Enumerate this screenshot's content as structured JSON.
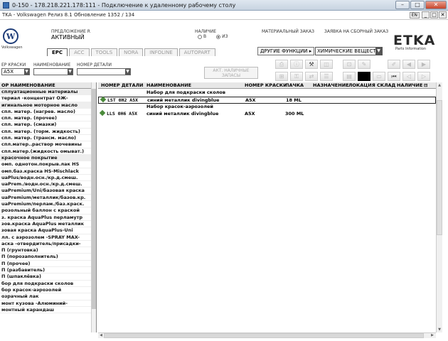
{
  "rdp": {
    "title": "0-150 - 178.218.221.178:111 - Подключение к удаленному рабочему столу",
    "min": "–",
    "max": "□",
    "close": "✕"
  },
  "etka_title": {
    "text": "TKA - Volkswagen Релиз 8.1 Обновление 1352 / 134",
    "lang": "EN",
    "min": "_",
    "max": "□",
    "close": "✕"
  },
  "header": {
    "brand_name": "Volkswagen",
    "offer_label": "ПРЕДЛОЖЕНИЕ R",
    "offer_value": "АКТИВНЫЙ",
    "availability_label": "НАЛИЧИЕ",
    "radio_b": "B",
    "radio_iz": "ИЗ",
    "material_order_label": "МАТЕРИАЛЬНЫЙ ЗАКАЗ",
    "collect_order_label": "ЗАЯВКА НА СБОРНЫЙ ЗАКАЗ",
    "logo": "ETKA",
    "logo_sub": "Parts Information"
  },
  "tabs": [
    "EPC",
    "ACC",
    "TOOLS",
    "NORA",
    "INFOLINE",
    "AUTOPART"
  ],
  "other_functions": "ДРУГИЕ ФУНКЦИИ ▸",
  "chem_select": "ХИМИЧЕСКИЕ ВЕЩЕСТ",
  "filters": {
    "paint_label": "ЕР КРАСКИ",
    "paint_value": "A5X",
    "name_label": "НАИМЕНОВАНИЕ",
    "part_label": "НОМЕР ДЕТАЛИ",
    "action_button": "АКТ. НАЛИЧНЫЕ ЗАПАСЫ"
  },
  "left_panel": {
    "header": "ОР НАИМЕНОВАНИЕ",
    "items": [
      {
        "label": "сплуатационные материалы",
        "group": true
      },
      {
        "label": "териал -концентрат ОЖ-",
        "group": false
      },
      {
        "label": "игинальное моторное масло",
        "group": true
      },
      {
        "label": "спл. матер. (нагрев. масло)",
        "group": false
      },
      {
        "label": "спл. матер. (прочее)",
        "group": false
      },
      {
        "label": "спл. матер. (смазки)",
        "group": false
      },
      {
        "label": "спл. матер. (торм. жидкость)",
        "group": false
      },
      {
        "label": "спл. матер. (трансм. масло)",
        "group": false
      },
      {
        "label": "спл.матер..раствор мочевины",
        "group": false
      },
      {
        "label": "спл.матер.(жидкость омыват.)",
        "group": false
      },
      {
        "label": "красочное покрытие",
        "group": true
      },
      {
        "label": "омп. однотон.покрыв.лак HS",
        "group": false
      },
      {
        "label": "омп.баз.краска HS-Mischlack",
        "group": false
      },
      {
        "label": "uaPlus/водн.осн./кр.д.смеш.",
        "group": false
      },
      {
        "label": "uaPrem./водн.осн./кр.д.смеш.",
        "group": false
      },
      {
        "label": "uaPremium/Uni/базовая краска",
        "group": false
      },
      {
        "label": "uaPremium/металлик/базов.кр.",
        "group": false
      },
      {
        "label": "uaPremium/перлам./баз.краск.",
        "group": false
      },
      {
        "label": "розольный баллон с краской",
        "group": false
      },
      {
        "label": "з. краска AquaPlus перламутр",
        "group": false
      },
      {
        "label": "зов.краска AquaPlus металлик",
        "group": false
      },
      {
        "label": "зовая краска AquaPlus-Uni",
        "group": false
      },
      {
        "label": "лл. с аэрозолем -SPRAY MAX-",
        "group": false
      },
      {
        "label": "аска -отвердитель/присадки-",
        "group": false
      },
      {
        "label": "П (грунтовка)",
        "group": false
      },
      {
        "label": "П (порозаполнитель)",
        "group": false
      },
      {
        "label": "П (прочее)",
        "group": false
      },
      {
        "label": "П (разбавитель)",
        "group": false
      },
      {
        "label": "П (шпаклёвка)",
        "group": false
      },
      {
        "label": "бор для подкраски сколов",
        "group": false
      },
      {
        "label": "бор красок-аэрозолей",
        "group": false
      },
      {
        "label": "озрачный лак",
        "group": false
      },
      {
        "label": "монт кузова -Алюминий-",
        "group": false
      },
      {
        "label": "монтный карандаш",
        "group": false
      }
    ]
  },
  "grid": {
    "columns": [
      "НОМЕР ДЕТАЛИ",
      "НАИМЕНОВАНИЕ",
      "НОМЕР КРАСКИ",
      "ПАЧКА",
      "НАЗНАЧЕНИЕ",
      "ЛОКАЦИЯ",
      "СКЛАД",
      "НАЛИЧИЕ"
    ],
    "rows": [
      {
        "part": "",
        "name": "Набор для подкраски сколов",
        "paint": "",
        "pack": "",
        "selected": false
      },
      {
        "part": "LST 0H2 A5X",
        "name": "синий металлик divingblue",
        "paint": "A5X",
        "pack": "18 ML",
        "selected": true
      },
      {
        "part": "",
        "name": "Набор красок-аэрозолей",
        "paint": "",
        "pack": "",
        "selected": false
      },
      {
        "part": "LLS 0H6 A5X",
        "name": "синий металлик divingblue",
        "paint": "A5X",
        "pack": "300 ML",
        "selected": false
      }
    ]
  }
}
